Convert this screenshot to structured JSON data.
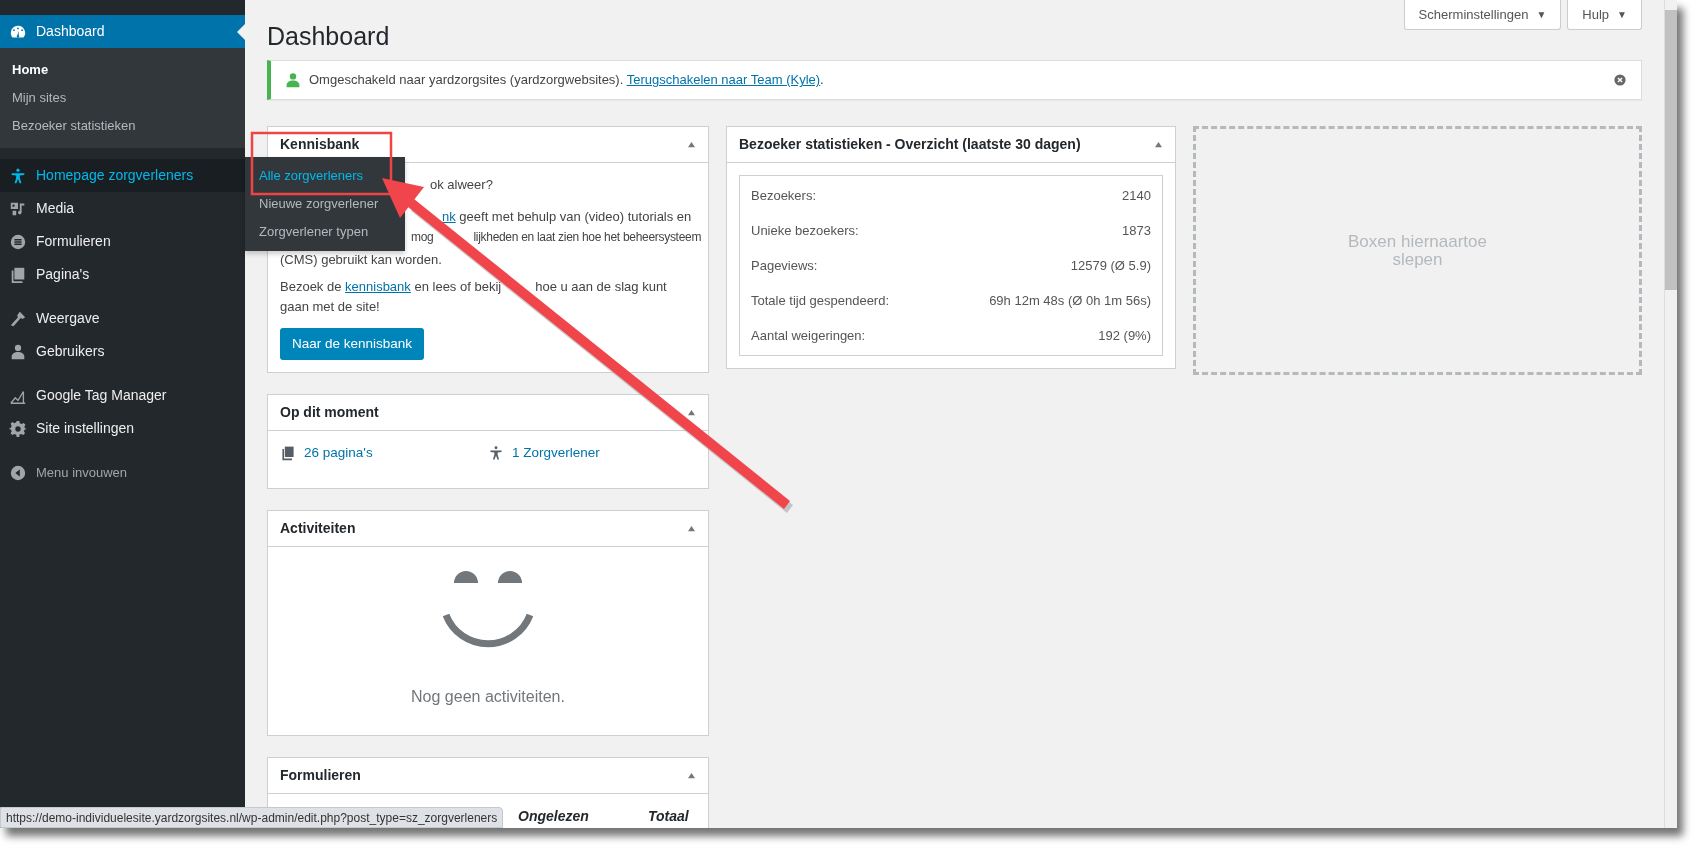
{
  "top_buttons": [
    {
      "label": "Scherminstellingen",
      "caret": "▼"
    },
    {
      "label": "Hulp",
      "caret": "▼"
    }
  ],
  "sidebar": {
    "groups": [
      [
        {
          "label": "Dashboard",
          "selected": true,
          "hovered": false,
          "children": [
            {
              "label": "Home",
              "selected": true
            },
            {
              "label": "Mijn sites",
              "selected": false
            },
            {
              "label": "Bezoeker statistieken",
              "selected": false
            }
          ]
        }
      ],
      [
        {
          "label": "Homepage zorgverleners",
          "selected": false,
          "hovered": true,
          "flyout": [
            {
              "label": "Alle zorgverleners",
              "selected": true
            },
            {
              "label": "Nieuwe zorgverlener",
              "selected": false
            },
            {
              "label": "Zorgverlener typen",
              "selected": false
            }
          ]
        },
        {
          "label": "Media",
          "selected": false,
          "hovered": false
        },
        {
          "label": "Formulieren",
          "selected": false,
          "hovered": false
        },
        {
          "label": "Pagina's",
          "selected": false,
          "hovered": false
        }
      ],
      [
        {
          "label": "Weergave",
          "selected": false,
          "hovered": false
        },
        {
          "label": "Gebruikers",
          "selected": false,
          "hovered": false
        }
      ],
      [
        {
          "label": "Google Tag Manager",
          "selected": false,
          "hovered": false
        },
        {
          "label": "Site instellingen",
          "selected": false,
          "hovered": false
        }
      ]
    ],
    "collapse": "Menu invouwen"
  },
  "page_title": "Dashboard",
  "notice": {
    "text": "Omgeschakeld naar yardzorgsites (yardzorgwebsites). ",
    "link": "Terugschakelen naar Team (Kyle)",
    "after": "."
  },
  "kennisbank": {
    "title": "Kennisbank",
    "line_1": "ok alweer?",
    "line_2_link": "nk",
    "line_2": " geeft met behulp van (video) tutorials en",
    "line_3": "mog",
    "line_3_rest": "lijkheden en laat zien hoe het beheersysteem",
    "line_4": "(CMS) gebruikt kan worden.",
    "visit_before": "Bezoek de ",
    "visit_link": "kennisbank",
    "visit_after": " en lees of bekij",
    "visit_rest": "hoe u aan de slag kunt gaan met de site!",
    "button": "Naar de kennisbank"
  },
  "op_dit_moment": {
    "title": "Op dit moment",
    "items": [
      {
        "label": "26 pagina's"
      },
      {
        "label": "1 Zorgverlener"
      }
    ]
  },
  "activiteiten": {
    "title": "Activiteiten",
    "empty": "Nog geen activiteiten."
  },
  "formulieren": {
    "title": "Formulieren",
    "columns": [
      "Ongelezen",
      "Totaal"
    ]
  },
  "stats": {
    "title": "Bezoeker statistieken - Overzicht (laatste 30 dagen)",
    "rows": [
      {
        "label": "Bezoekers:",
        "value": "2140"
      },
      {
        "label": "Unieke bezoekers:",
        "value": "1873"
      },
      {
        "label": "Pageviews:",
        "value": "12579 (Ø 5.9)"
      },
      {
        "label": "Totale tijd gespendeerd:",
        "value": "69h 12m 48s (Ø 0h 1m 56s)"
      },
      {
        "label": "Aantal weigeringen:",
        "value": "192 (9%)"
      }
    ]
  },
  "drop_zone": "Boxen hiernaartoe slepen",
  "status_url": "https://demo-individuelesite.yardzorgsites.nl/wp-admin/edit.php?post_type=sz_zorgverleners"
}
